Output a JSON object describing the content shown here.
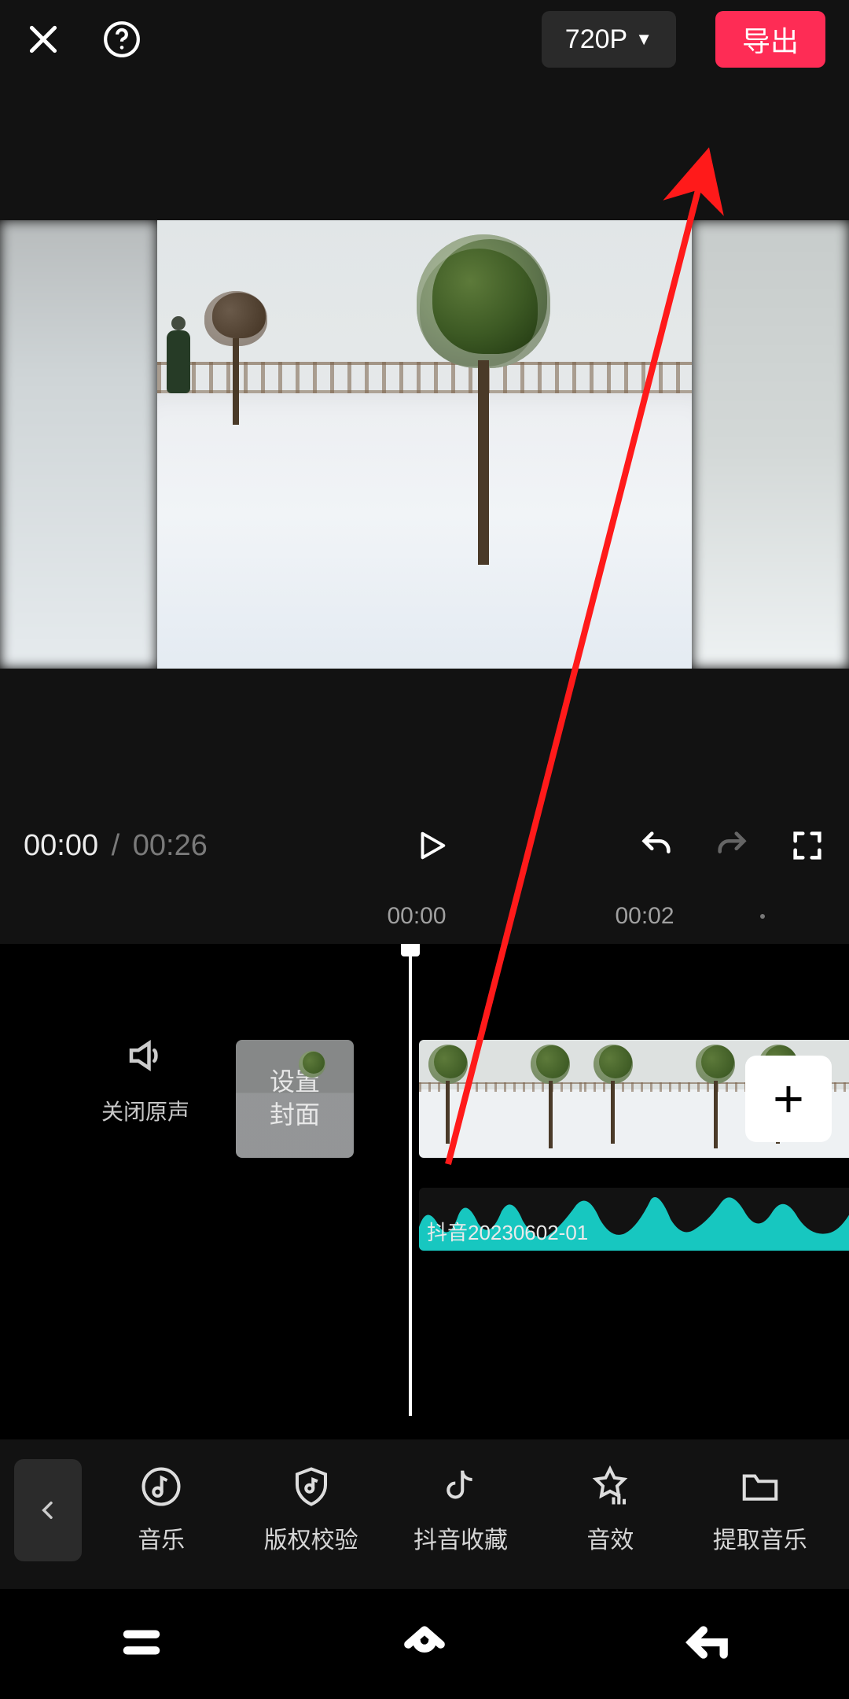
{
  "topbar": {
    "resolution_label": "720P",
    "export_label": "导出"
  },
  "playback": {
    "current_time": "00:00",
    "separator": "/",
    "total_time": "00:26"
  },
  "ruler": {
    "mark_a": "00:00",
    "mark_b": "00:02"
  },
  "timeline": {
    "mute_label": "关闭原声",
    "cover_label": "设置\n封面",
    "add_label": "+",
    "audio_clip_name": "抖音20230602-01"
  },
  "toolbar": {
    "items": [
      {
        "label": "音乐"
      },
      {
        "label": "版权校验"
      },
      {
        "label": "抖音收藏"
      },
      {
        "label": "音效"
      },
      {
        "label": "提取音乐"
      }
    ]
  },
  "annotation": {
    "arrow_color": "#ff1a1a"
  }
}
